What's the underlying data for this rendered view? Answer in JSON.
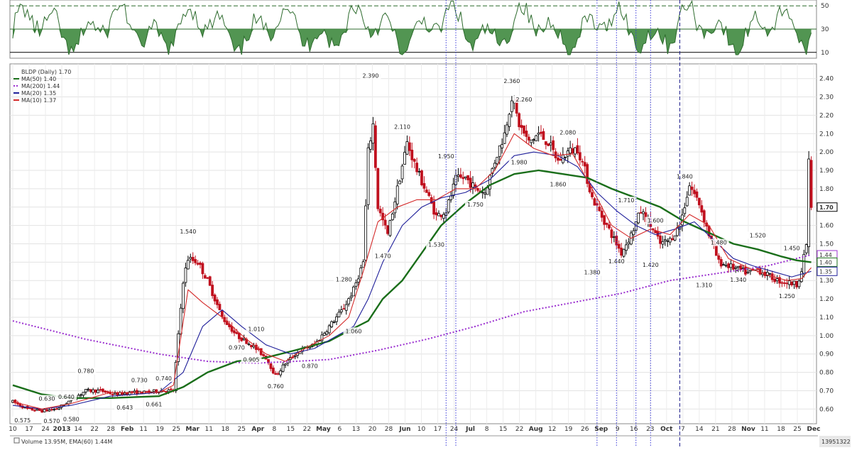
{
  "chart_data": {
    "type": "candlestick",
    "symbol_line": "BLDP (Daily) 1.70",
    "legend": [
      {
        "label": "MA(50) 1.40",
        "color": "#1a6e1a"
      },
      {
        "label": "MA(200) 1.44",
        "color": "#9b30d0"
      },
      {
        "label": "MA(20) 1.35",
        "color": "#1f1f9a"
      },
      {
        "label": "MA(10) 1.37",
        "color": "#d42a2a"
      }
    ],
    "y_ticks": [
      2.4,
      2.3,
      2.2,
      2.1,
      2.0,
      1.9,
      1.8,
      1.7,
      1.6,
      1.5,
      1.4,
      1.3,
      1.2,
      1.1,
      1.0,
      0.9,
      0.8,
      0.7,
      0.6
    ],
    "y_tick_labels": [
      "2.40",
      "2.30",
      "2.20",
      "2.10",
      "2.00",
      "1.90",
      "1.80",
      "1.70",
      "1.60",
      "1.50",
      "1.40",
      "1.30",
      "1.20",
      "1.10",
      "1.00",
      "0.90",
      "0.80",
      "0.70",
      "0.60"
    ],
    "ylim": [
      0.52,
      2.48
    ],
    "x_tick_labels": [
      "10",
      "17",
      "24",
      "2013",
      "14",
      "22",
      "28",
      "Feb",
      "11",
      "19",
      "25",
      "Mar",
      "11",
      "18",
      "25",
      "Apr",
      "8",
      "15",
      "22",
      "May",
      "6",
      "13",
      "20",
      "28",
      "Jun",
      "10",
      "17",
      "24",
      "Jul",
      "8",
      "15",
      "22",
      "Aug",
      "12",
      "19",
      "26",
      "Sep",
      "9",
      "16",
      "23",
      "Oct",
      "7",
      "14",
      "21",
      "28",
      "Nov",
      "11",
      "18",
      "25",
      "Dec"
    ],
    "x_bold": [
      "2013",
      "Feb",
      "Mar",
      "Apr",
      "May",
      "Jun",
      "Jul",
      "Aug",
      "Sep",
      "Oct",
      "Nov",
      "Dec"
    ],
    "price_path": [
      [
        0,
        0.64
      ],
      [
        6,
        0.6
      ],
      [
        12,
        0.59
      ],
      [
        18,
        0.6
      ],
      [
        24,
        0.65
      ],
      [
        30,
        0.7
      ],
      [
        36,
        0.7
      ],
      [
        42,
        0.68
      ],
      [
        48,
        0.69
      ],
      [
        54,
        0.69
      ],
      [
        60,
        0.7
      ],
      [
        66,
        0.7
      ],
      [
        70,
        1.3
      ],
      [
        72,
        1.42
      ],
      [
        76,
        1.4
      ],
      [
        80,
        1.3
      ],
      [
        86,
        1.1
      ],
      [
        92,
        1.0
      ],
      [
        98,
        0.95
      ],
      [
        104,
        0.88
      ],
      [
        108,
        0.78
      ],
      [
        112,
        0.85
      ],
      [
        118,
        0.92
      ],
      [
        124,
        0.95
      ],
      [
        130,
        1.05
      ],
      [
        136,
        1.15
      ],
      [
        140,
        1.25
      ],
      [
        144,
        1.4
      ],
      [
        146,
        2.0
      ],
      [
        148,
        2.15
      ],
      [
        150,
        1.7
      ],
      [
        154,
        1.55
      ],
      [
        158,
        1.8
      ],
      [
        162,
        2.05
      ],
      [
        166,
        1.9
      ],
      [
        170,
        1.78
      ],
      [
        174,
        1.65
      ],
      [
        178,
        1.68
      ],
      [
        182,
        1.85
      ],
      [
        186,
        1.86
      ],
      [
        190,
        1.8
      ],
      [
        194,
        1.78
      ],
      [
        198,
        1.95
      ],
      [
        202,
        2.1
      ],
      [
        205,
        2.3
      ],
      [
        208,
        2.15
      ],
      [
        212,
        2.05
      ],
      [
        216,
        2.1
      ],
      [
        220,
        2.05
      ],
      [
        224,
        1.95
      ],
      [
        228,
        2.0
      ],
      [
        232,
        2.02
      ],
      [
        235,
        1.9
      ],
      [
        238,
        1.75
      ],
      [
        242,
        1.65
      ],
      [
        246,
        1.55
      ],
      [
        250,
        1.45
      ],
      [
        254,
        1.55
      ],
      [
        258,
        1.68
      ],
      [
        262,
        1.6
      ],
      [
        266,
        1.5
      ],
      [
        270,
        1.52
      ],
      [
        274,
        1.6
      ],
      [
        278,
        1.82
      ],
      [
        282,
        1.72
      ],
      [
        286,
        1.55
      ],
      [
        290,
        1.4
      ],
      [
        294,
        1.38
      ],
      [
        298,
        1.36
      ],
      [
        302,
        1.34
      ],
      [
        306,
        1.36
      ],
      [
        310,
        1.33
      ],
      [
        314,
        1.3
      ],
      [
        318,
        1.29
      ],
      [
        322,
        1.28
      ],
      [
        324,
        1.35
      ],
      [
        326,
        1.5
      ],
      [
        327,
        1.95
      ],
      [
        328,
        1.7
      ]
    ],
    "ma10": [
      [
        0,
        0.64
      ],
      [
        12,
        0.6
      ],
      [
        24,
        0.63
      ],
      [
        40,
        0.69
      ],
      [
        60,
        0.69
      ],
      [
        66,
        0.73
      ],
      [
        72,
        1.25
      ],
      [
        78,
        1.18
      ],
      [
        86,
        1.1
      ],
      [
        96,
        0.98
      ],
      [
        104,
        0.9
      ],
      [
        112,
        0.86
      ],
      [
        120,
        0.93
      ],
      [
        130,
        1.0
      ],
      [
        138,
        1.1
      ],
      [
        144,
        1.35
      ],
      [
        150,
        1.62
      ],
      [
        158,
        1.7
      ],
      [
        166,
        1.74
      ],
      [
        174,
        1.74
      ],
      [
        182,
        1.8
      ],
      [
        190,
        1.8
      ],
      [
        198,
        1.9
      ],
      [
        206,
        2.1
      ],
      [
        214,
        2.02
      ],
      [
        222,
        1.98
      ],
      [
        230,
        1.99
      ],
      [
        238,
        1.8
      ],
      [
        246,
        1.6
      ],
      [
        254,
        1.53
      ],
      [
        262,
        1.58
      ],
      [
        270,
        1.55
      ],
      [
        278,
        1.66
      ],
      [
        286,
        1.6
      ],
      [
        294,
        1.42
      ],
      [
        302,
        1.37
      ],
      [
        310,
        1.33
      ],
      [
        318,
        1.3
      ],
      [
        324,
        1.31
      ],
      [
        328,
        1.37
      ]
    ],
    "ma20": [
      [
        0,
        0.62
      ],
      [
        12,
        0.6
      ],
      [
        24,
        0.62
      ],
      [
        40,
        0.67
      ],
      [
        60,
        0.69
      ],
      [
        70,
        0.8
      ],
      [
        78,
        1.05
      ],
      [
        86,
        1.14
      ],
      [
        94,
        1.05
      ],
      [
        104,
        0.95
      ],
      [
        114,
        0.9
      ],
      [
        124,
        0.93
      ],
      [
        132,
        0.99
      ],
      [
        140,
        1.05
      ],
      [
        146,
        1.2
      ],
      [
        152,
        1.4
      ],
      [
        160,
        1.6
      ],
      [
        168,
        1.7
      ],
      [
        176,
        1.75
      ],
      [
        186,
        1.78
      ],
      [
        196,
        1.85
      ],
      [
        206,
        1.98
      ],
      [
        214,
        2.0
      ],
      [
        224,
        1.98
      ],
      [
        232,
        1.92
      ],
      [
        240,
        1.78
      ],
      [
        248,
        1.68
      ],
      [
        256,
        1.6
      ],
      [
        264,
        1.55
      ],
      [
        272,
        1.58
      ],
      [
        280,
        1.62
      ],
      [
        288,
        1.52
      ],
      [
        296,
        1.42
      ],
      [
        304,
        1.38
      ],
      [
        312,
        1.35
      ],
      [
        320,
        1.32
      ],
      [
        328,
        1.35
      ]
    ],
    "ma50": [
      [
        0,
        0.73
      ],
      [
        12,
        0.68
      ],
      [
        24,
        0.66
      ],
      [
        40,
        0.66
      ],
      [
        60,
        0.67
      ],
      [
        70,
        0.72
      ],
      [
        80,
        0.8
      ],
      [
        92,
        0.86
      ],
      [
        104,
        0.88
      ],
      [
        116,
        0.92
      ],
      [
        130,
        0.97
      ],
      [
        140,
        1.04
      ],
      [
        146,
        1.08
      ],
      [
        152,
        1.2
      ],
      [
        160,
        1.3
      ],
      [
        168,
        1.45
      ],
      [
        176,
        1.6
      ],
      [
        186,
        1.72
      ],
      [
        196,
        1.82
      ],
      [
        206,
        1.88
      ],
      [
        216,
        1.9
      ],
      [
        226,
        1.88
      ],
      [
        236,
        1.86
      ],
      [
        246,
        1.8
      ],
      [
        256,
        1.75
      ],
      [
        266,
        1.7
      ],
      [
        276,
        1.62
      ],
      [
        286,
        1.56
      ],
      [
        296,
        1.5
      ],
      [
        306,
        1.47
      ],
      [
        316,
        1.43
      ],
      [
        322,
        1.41
      ],
      [
        328,
        1.4
      ]
    ],
    "ma200": [
      [
        0,
        1.08
      ],
      [
        30,
        0.98
      ],
      [
        60,
        0.9
      ],
      [
        80,
        0.86
      ],
      [
        100,
        0.85
      ],
      [
        116,
        0.86
      ],
      [
        130,
        0.87
      ],
      [
        150,
        0.92
      ],
      [
        170,
        0.98
      ],
      [
        190,
        1.05
      ],
      [
        210,
        1.13
      ],
      [
        230,
        1.18
      ],
      [
        250,
        1.23
      ],
      [
        270,
        1.3
      ],
      [
        290,
        1.34
      ],
      [
        310,
        1.38
      ],
      [
        328,
        1.44
      ]
    ],
    "annotations": [
      {
        "text": "2.390",
        "i": 147,
        "v": 2.39
      },
      {
        "text": "2.360",
        "i": 205,
        "v": 2.36
      },
      {
        "text": "2.260",
        "i": 210,
        "v": 2.26
      },
      {
        "text": "2.110",
        "i": 160,
        "v": 2.11
      },
      {
        "text": "2.080",
        "i": 228,
        "v": 2.08
      },
      {
        "text": "1.980",
        "i": 208,
        "v": 1.98
      },
      {
        "text": "1.950",
        "i": 178,
        "v": 1.95
      },
      {
        "text": "1.860",
        "i": 224,
        "v": 1.86
      },
      {
        "text": "1.840",
        "i": 276,
        "v": 1.84
      },
      {
        "text": "1.750",
        "i": 190,
        "v": 1.75
      },
      {
        "text": "1.710",
        "i": 252,
        "v": 1.71
      },
      {
        "text": "1.600",
        "i": 264,
        "v": 1.6
      },
      {
        "text": "1.540",
        "i": 72,
        "v": 1.54
      },
      {
        "text": "1.530",
        "i": 174,
        "v": 1.53
      },
      {
        "text": "1.520",
        "i": 306,
        "v": 1.52
      },
      {
        "text": "1.480",
        "i": 290,
        "v": 1.48
      },
      {
        "text": "1.470",
        "i": 152,
        "v": 1.47
      },
      {
        "text": "1.450",
        "i": 320,
        "v": 1.45
      },
      {
        "text": "1.440",
        "i": 248,
        "v": 1.44
      },
      {
        "text": "1.420",
        "i": 262,
        "v": 1.42
      },
      {
        "text": "1.380",
        "i": 238,
        "v": 1.38
      },
      {
        "text": "1.340",
        "i": 298,
        "v": 1.34
      },
      {
        "text": "1.310",
        "i": 284,
        "v": 1.31
      },
      {
        "text": "1.280",
        "i": 136,
        "v": 1.28
      },
      {
        "text": "1.250",
        "i": 318,
        "v": 1.25
      },
      {
        "text": "1.060",
        "i": 140,
        "v": 1.06
      },
      {
        "text": "1.010",
        "i": 100,
        "v": 1.01
      },
      {
        "text": "0.970",
        "i": 92,
        "v": 0.97
      },
      {
        "text": "0.905",
        "i": 98,
        "v": 0.905
      },
      {
        "text": "0.870",
        "i": 122,
        "v": 0.87
      },
      {
        "text": "0.780",
        "i": 30,
        "v": 0.78
      },
      {
        "text": "0.760",
        "i": 108,
        "v": 0.76
      },
      {
        "text": "0.740",
        "i": 62,
        "v": 0.74
      },
      {
        "text": "0.730",
        "i": 52,
        "v": 0.73
      },
      {
        "text": "0.661",
        "i": 58,
        "v": 0.661
      },
      {
        "text": "0.643",
        "i": 46,
        "v": 0.643
      },
      {
        "text": "0.640",
        "i": 22,
        "v": 0.64
      },
      {
        "text": "0.630",
        "i": 14,
        "v": 0.63
      },
      {
        "text": "0.580",
        "i": 24,
        "v": 0.58
      },
      {
        "text": "0.575",
        "i": 4,
        "v": 0.575
      },
      {
        "text": "0.570",
        "i": 16,
        "v": 0.57
      }
    ],
    "right_tags": [
      {
        "text": "1.70",
        "v": 1.7,
        "bold": true,
        "color": "#000000"
      },
      {
        "text": "1.44",
        "v": 1.44,
        "bold": false,
        "color": "#9b30d0"
      },
      {
        "text": "1.40",
        "v": 1.4,
        "bold": false,
        "color": "#1a6e1a"
      },
      {
        "text": "1.35",
        "v": 1.35,
        "bold": false,
        "color": "#1f1f9a"
      }
    ],
    "rsi": {
      "ticks": [
        "50",
        "30",
        "10"
      ],
      "tick_values": [
        50,
        30,
        10
      ],
      "oversold": 30,
      "ylim": [
        5,
        55
      ]
    },
    "vlines_blue_idx": [
      178,
      182,
      240,
      248,
      256,
      262
    ],
    "vline_navy_idx": 274,
    "volume": {
      "label": "Volume 13.95M, EMA(60) 1.44M",
      "right_text": "13951322"
    },
    "colors": {
      "up_candle": "#000000",
      "down_candle": "#c0101e",
      "grid": "#e3e3e3",
      "rsi_fill": "#3f8a3f",
      "rsi_line": "#2d6b2d",
      "vline_blue": "#3a3ad8",
      "vline_navy": "#1b1b8a"
    }
  }
}
